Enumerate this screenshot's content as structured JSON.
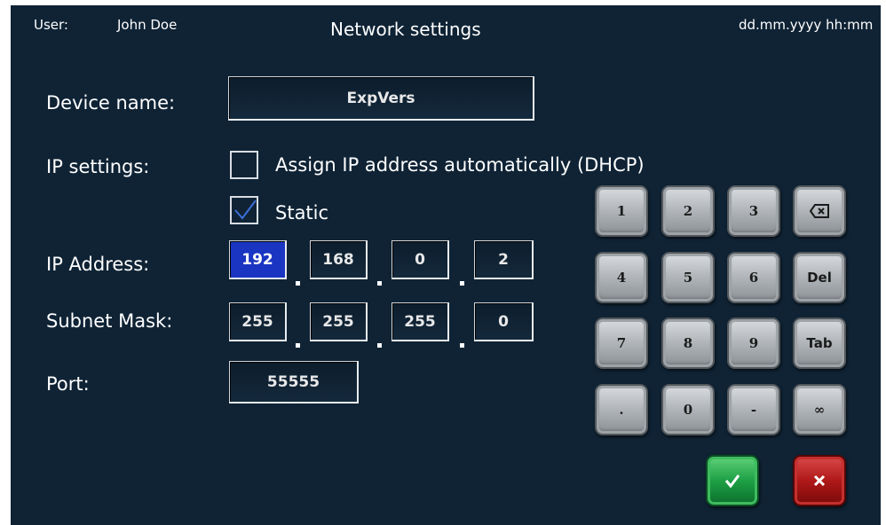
{
  "header": {
    "user_label": "User:",
    "user_name": "John Doe",
    "title": "Network settings",
    "datetime": "dd.mm.yyyy hh:mm"
  },
  "form": {
    "device_name_label": "Device name:",
    "device_name_value": "ExpVers",
    "ip_settings_label": "IP settings:",
    "dhcp_label": "Assign IP address automatically (DHCP)",
    "dhcp_checked": false,
    "static_label": "Static",
    "static_checked": true,
    "ip_address_label": "IP Address:",
    "ip_address": [
      "192",
      "168",
      "0",
      "2"
    ],
    "subnet_label": "Subnet Mask:",
    "subnet": [
      "255",
      "255",
      "255",
      "0"
    ],
    "port_label": "Port:",
    "port_value": "55555"
  },
  "keypad": {
    "keys": [
      "1",
      "2",
      "3",
      "backspace-icon",
      "4",
      "5",
      "6",
      "Del",
      "7",
      "8",
      "9",
      "Tab",
      ".",
      "0",
      "-",
      "∞"
    ],
    "confirm_icon": "checkmark-icon",
    "cancel_icon": "close-icon"
  },
  "colors": {
    "background": "#0f2335",
    "active_field": "#1a35c2",
    "confirm": "#1ea046",
    "cancel": "#b01818"
  }
}
